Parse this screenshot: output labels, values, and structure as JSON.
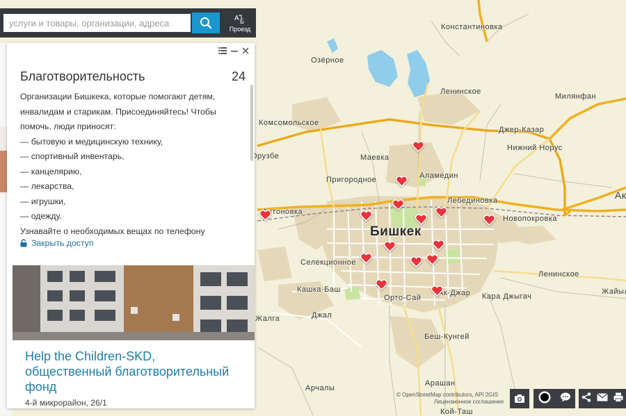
{
  "search": {
    "placeholder": "услуги и товары, организации, адреса",
    "route_label": "Проезд"
  },
  "panel": {
    "title": "Благотворительность",
    "count": "24",
    "description": [
      "Организации Бишкека, которые помогают детям, инвалидам и старикам. Присоединяйтесь! Чтобы помочь, люди приносят:",
      "— бытовую и медицинскую технику,",
      "— спортивный инвентарь,",
      "— канцелярию,",
      "— лекарства,",
      "— игрушки,",
      "— одежду.",
      "Узнавайте о необходимых вещах по телефону"
    ],
    "access_link": "Закрыть доступ",
    "card": {
      "title": "Help the Children-SKD, общественный благотворительный фонд",
      "address": "4-й микрорайон, 26/1"
    }
  },
  "map": {
    "city_label": "Бишкек",
    "places": [
      "Константиновка",
      "Озёрное",
      "Ленинское",
      "Милянфан",
      "Комсомольское",
      "Джер-Казар",
      "Нижний Норус",
      "Орузбе",
      "Маевка",
      "Пригородное",
      "Аламедин",
      "Лебединовка",
      "Новопокровка",
      "Ак-Кайын",
      "Антоновка",
      "Селекционное",
      "Ленинское",
      "Кашка-Баш",
      "Орто-Сай",
      "Ак-Джар",
      "Кара Джыгач",
      "Жайыл",
      "Жалга",
      "Джал",
      "Беш-Кунгей",
      "Арашан",
      "Арчалы",
      "Кой-Таш"
    ],
    "marker_icon": "heart-marker-icon",
    "marker_color": "#e8353b"
  },
  "attribution": {
    "line1": "© OpenStreetMap contributors, API 2GIS",
    "line2": "Лицензионное соглашение"
  },
  "toolbar": {
    "icons": [
      "camera-icon",
      "record-icon",
      "comment-icon",
      "share-icon",
      "mail-icon",
      "print-icon"
    ]
  },
  "colors": {
    "search_button": "#1b96ce",
    "link": "#1f7ea6",
    "road_major": "#f1b124",
    "water": "#8ccbe8",
    "urban": "#e2d3b3"
  }
}
